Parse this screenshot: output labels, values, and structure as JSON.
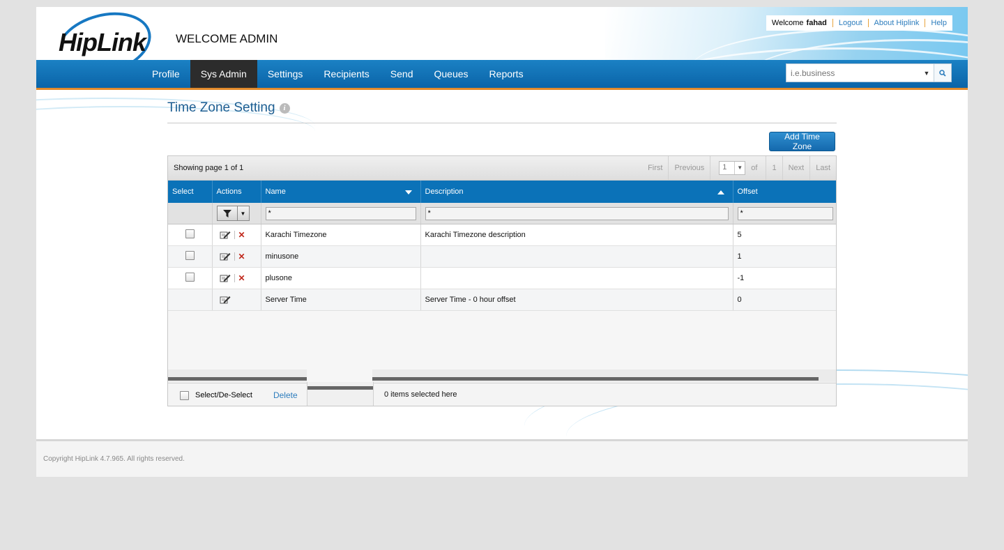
{
  "header": {
    "logo_text": "HipLink",
    "welcome_title": "WELCOME ADMIN",
    "welcome_prefix": "Welcome",
    "username": "fahad",
    "links": [
      "Logout",
      "About Hiplink",
      "Help"
    ]
  },
  "nav": {
    "items": [
      "Profile",
      "Sys Admin",
      "Settings",
      "Recipients",
      "Send",
      "Queues",
      "Reports"
    ],
    "active": "Sys Admin",
    "search_placeholder": "i.e.business"
  },
  "page": {
    "title": "Time Zone Setting",
    "add_button": "Add Time Zone"
  },
  "grid": {
    "showing": "Showing page 1 of 1",
    "pager": {
      "first": "First",
      "previous": "Previous",
      "current_page": "1",
      "of": "of",
      "total_pages": "1",
      "next": "Next",
      "last": "Last"
    },
    "columns": [
      "Select",
      "Actions",
      "Name",
      "Description",
      "Offset"
    ],
    "filters": {
      "name": "*",
      "description": "*",
      "offset": "*"
    },
    "rows": [
      {
        "name": "Karachi Timezone",
        "description": "Karachi Timezone description",
        "offset": "5",
        "selectable": true,
        "deletable": true
      },
      {
        "name": "minusone",
        "description": "",
        "offset": "1",
        "selectable": true,
        "deletable": true
      },
      {
        "name": "plusone",
        "description": "",
        "offset": "-1",
        "selectable": true,
        "deletable": true
      },
      {
        "name": "Server Time",
        "description": "Server Time - 0 hour offset",
        "offset": "0",
        "selectable": false,
        "deletable": false
      }
    ],
    "footer": {
      "select_label": "Select/De-Select",
      "delete_label": "Delete",
      "selected_count": "0 items selected here"
    }
  },
  "footer": {
    "copyright": "Copyright HipLink 4.7.965. All rights reserved."
  },
  "colors": {
    "nav_blue": "#0b72b8",
    "active_tab": "#2c2c2c",
    "accent_orange": "#e28a2b",
    "link_blue": "#2d7dbd",
    "delete_red": "#c0281c"
  }
}
